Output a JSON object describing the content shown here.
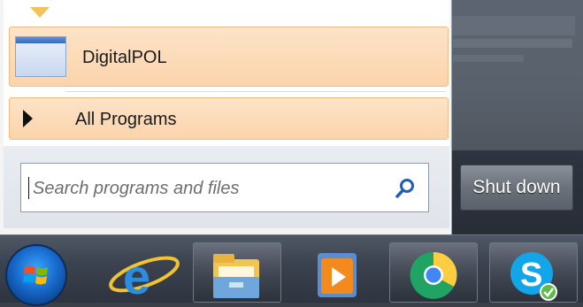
{
  "start_menu": {
    "pinned_program": {
      "label": "DigitalPOL"
    },
    "all_programs": {
      "label": "All Programs"
    },
    "search": {
      "placeholder": "Search programs and files",
      "value": ""
    },
    "shutdown": {
      "label": "Shut down"
    }
  },
  "taskbar": {
    "items": [
      {
        "name": "Start",
        "icon": "windows-orb-icon"
      },
      {
        "name": "Internet Explorer",
        "icon": "internet-explorer-icon"
      },
      {
        "name": "Windows Explorer",
        "icon": "folder-icon"
      },
      {
        "name": "Media",
        "icon": "media-player-icon"
      },
      {
        "name": "Google Chrome",
        "icon": "chrome-icon"
      },
      {
        "name": "Skype",
        "icon": "skype-icon"
      }
    ]
  },
  "colors": {
    "highlight": "#fbd4ab",
    "highlight_border": "#f2bc86",
    "taskbar": "#3c4350",
    "new_program_marker": "#f4c25a"
  }
}
